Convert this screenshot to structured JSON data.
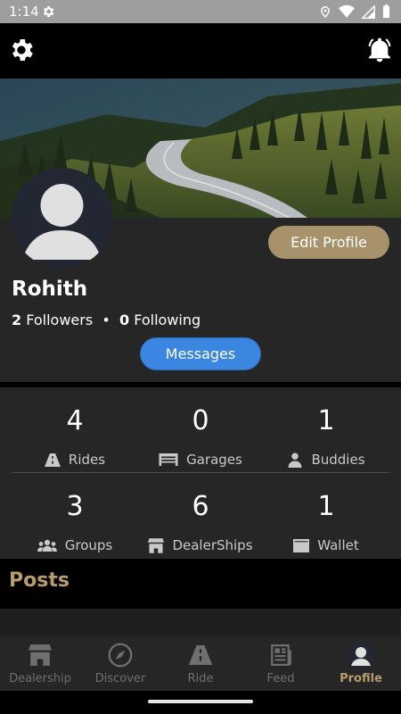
{
  "status_bar": {
    "time": "1:14"
  },
  "profile": {
    "name": "Rohith",
    "followers_count": "2",
    "followers_label": "Followers",
    "separator": "•",
    "following_count": "0",
    "following_label": "Following",
    "edit_label": "Edit Profile",
    "messages_label": "Messages"
  },
  "stats": [
    {
      "value": "4",
      "label": "Rides",
      "icon": "road-icon"
    },
    {
      "value": "0",
      "label": "Garages",
      "icon": "garage-icon"
    },
    {
      "value": "1",
      "label": "Buddies",
      "icon": "person-icon"
    },
    {
      "value": "3",
      "label": "Groups",
      "icon": "group-icon"
    },
    {
      "value": "6",
      "label": "DealerShips",
      "icon": "store-icon"
    },
    {
      "value": "1",
      "label": "Wallet",
      "icon": "wallet-icon"
    }
  ],
  "posts": {
    "title": "Posts"
  },
  "nav": [
    {
      "label": "Dealership",
      "icon": "store-icon"
    },
    {
      "label": "Discover",
      "icon": "compass-icon"
    },
    {
      "label": "Ride",
      "icon": "road-icon"
    },
    {
      "label": "Feed",
      "icon": "newspaper-icon"
    },
    {
      "label": "Profile",
      "icon": "avatar-icon",
      "active": true
    }
  ],
  "colors": {
    "accent": "#b89c6b",
    "messages": "#3b86e0",
    "card": "#262626"
  }
}
